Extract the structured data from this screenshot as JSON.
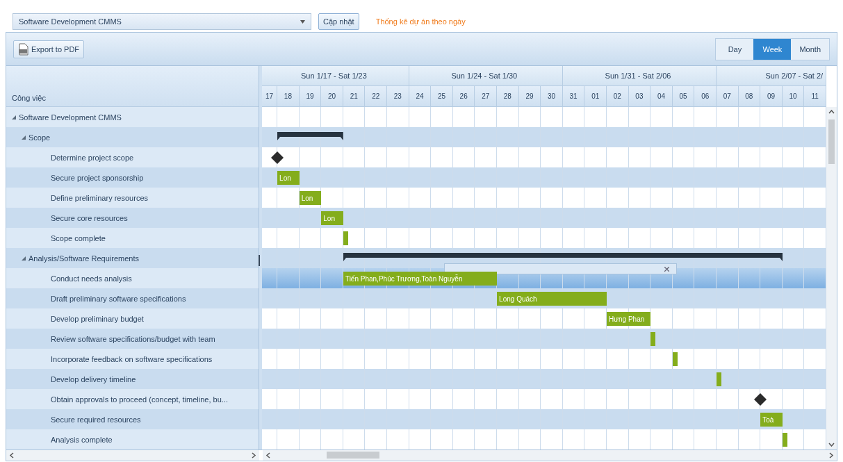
{
  "top_bar": {
    "project_select": {
      "value": "Software Development CMMS"
    },
    "update_button": "Cập nhật",
    "stats_link": "Thống kê dự án theo ngày"
  },
  "toolbar": {
    "export_button": "Export to PDF",
    "views": [
      {
        "label": "Day",
        "selected": false
      },
      {
        "label": "Week",
        "selected": true
      },
      {
        "label": "Month",
        "selected": false
      }
    ]
  },
  "gantt": {
    "column_header": "Công việc",
    "weeks": [
      "Sun 1/17 - Sat 1/23",
      "Sun 1/24 - Sat 1/30",
      "Sun 1/31 - Sat 2/06",
      "Sun 2/07 - Sat 2/"
    ],
    "days": [
      "17",
      "18",
      "19",
      "20",
      "21",
      "22",
      "23",
      "24",
      "25",
      "26",
      "27",
      "28",
      "29",
      "30",
      "31",
      "01",
      "02",
      "03",
      "04",
      "05",
      "06",
      "07",
      "08",
      "09",
      "10",
      "11"
    ],
    "tasks": [
      {
        "name": "Software Development CMMS",
        "expanded": true,
        "selected": false,
        "children": [
          {
            "name": "Scope",
            "expanded": true,
            "selected": false,
            "bar": {
              "kind": "summary",
              "days": [
                false,
                true,
                true,
                true,
                false,
                false,
                false,
                false,
                false,
                false,
                false,
                false,
                false,
                false,
                false,
                false,
                false,
                false,
                false,
                false,
                false,
                false,
                false,
                false,
                false,
                false
              ]
            },
            "children": [
              {
                "name": "Determine project scope",
                "selected": false,
                "bar": {
                  "kind": "milestone",
                  "days": [
                    false,
                    true,
                    false,
                    false,
                    false,
                    false,
                    false,
                    false,
                    false,
                    false,
                    false,
                    false,
                    false,
                    false,
                    false,
                    false,
                    false,
                    false,
                    false,
                    false,
                    false,
                    false,
                    false,
                    false,
                    false,
                    false
                  ]
                }
              },
              {
                "name": "Secure project sponsorship",
                "selected": false,
                "bar": {
                  "kind": "task",
                  "label": "Lon",
                  "days": [
                    false,
                    true,
                    false,
                    false,
                    false,
                    false,
                    false,
                    false,
                    false,
                    false,
                    false,
                    false,
                    false,
                    false,
                    false,
                    false,
                    false,
                    false,
                    false,
                    false,
                    false,
                    false,
                    false,
                    false,
                    false,
                    false
                  ]
                }
              },
              {
                "name": "Define preliminary resources",
                "selected": false,
                "bar": {
                  "kind": "task",
                  "label": "Lon",
                  "days": [
                    false,
                    false,
                    true,
                    false,
                    false,
                    false,
                    false,
                    false,
                    false,
                    false,
                    false,
                    false,
                    false,
                    false,
                    false,
                    false,
                    false,
                    false,
                    false,
                    false,
                    false,
                    false,
                    false,
                    false,
                    false,
                    false
                  ]
                }
              },
              {
                "name": "Secure core resources",
                "selected": false,
                "bar": {
                  "kind": "task",
                  "label": "Lon",
                  "days": [
                    false,
                    false,
                    false,
                    true,
                    false,
                    false,
                    false,
                    false,
                    false,
                    false,
                    false,
                    false,
                    false,
                    false,
                    false,
                    false,
                    false,
                    false,
                    false,
                    false,
                    false,
                    false,
                    false,
                    false,
                    false,
                    false
                  ]
                }
              },
              {
                "name": "Scope complete",
                "selected": false,
                "bar": {
                  "kind": "tick",
                  "days": [
                    false,
                    false,
                    false,
                    false,
                    true,
                    false,
                    false,
                    false,
                    false,
                    false,
                    false,
                    false,
                    false,
                    false,
                    false,
                    false,
                    false,
                    false,
                    false,
                    false,
                    false,
                    false,
                    false,
                    false,
                    false,
                    false
                  ]
                }
              }
            ]
          },
          {
            "name": "Analysis/Software Requirements",
            "expanded": true,
            "selected": false,
            "bar": {
              "kind": "summary",
              "days": [
                false,
                false,
                false,
                false,
                true,
                true,
                true,
                true,
                true,
                true,
                true,
                true,
                true,
                true,
                true,
                true,
                true,
                true,
                true,
                true,
                true,
                true,
                true,
                true,
                false,
                false
              ]
            },
            "children": [
              {
                "name": "Conduct needs analysis",
                "selected": true,
                "bar": {
                  "kind": "task",
                  "label": "Tiến Phan,Phúc Trương,Toàn Nguyễn",
                  "days": [
                    false,
                    false,
                    false,
                    false,
                    true,
                    true,
                    true,
                    true,
                    true,
                    true,
                    true,
                    false,
                    false,
                    false,
                    false,
                    false,
                    false,
                    false,
                    false,
                    false,
                    false,
                    false,
                    false,
                    false,
                    false,
                    false
                  ]
                }
              },
              {
                "name": "Draft preliminary software specifications",
                "selected": false,
                "bar": {
                  "kind": "task",
                  "label": "Long Quách",
                  "days": [
                    false,
                    false,
                    false,
                    false,
                    false,
                    false,
                    false,
                    false,
                    false,
                    false,
                    false,
                    true,
                    true,
                    true,
                    true,
                    true,
                    false,
                    false,
                    false,
                    false,
                    false,
                    false,
                    false,
                    false,
                    false,
                    false
                  ]
                }
              },
              {
                "name": "Develop preliminary budget",
                "selected": false,
                "bar": {
                  "kind": "task",
                  "label": "Hưng Phan",
                  "days": [
                    false,
                    false,
                    false,
                    false,
                    false,
                    false,
                    false,
                    false,
                    false,
                    false,
                    false,
                    false,
                    false,
                    false,
                    false,
                    false,
                    true,
                    true,
                    false,
                    false,
                    false,
                    false,
                    false,
                    false,
                    false,
                    false
                  ]
                }
              },
              {
                "name": "Review software specifications/budget with team",
                "selected": false,
                "bar": {
                  "kind": "tick",
                  "days": [
                    false,
                    false,
                    false,
                    false,
                    false,
                    false,
                    false,
                    false,
                    false,
                    false,
                    false,
                    false,
                    false,
                    false,
                    false,
                    false,
                    false,
                    false,
                    true,
                    false,
                    false,
                    false,
                    false,
                    false,
                    false,
                    false
                  ]
                }
              },
              {
                "name": "Incorporate feedback on software specifications",
                "selected": false,
                "bar": {
                  "kind": "tick",
                  "days": [
                    false,
                    false,
                    false,
                    false,
                    false,
                    false,
                    false,
                    false,
                    false,
                    false,
                    false,
                    false,
                    false,
                    false,
                    false,
                    false,
                    false,
                    false,
                    false,
                    true,
                    false,
                    false,
                    false,
                    false,
                    false,
                    false
                  ]
                }
              },
              {
                "name": "Develop delivery timeline",
                "selected": false,
                "bar": {
                  "kind": "tick",
                  "days": [
                    false,
                    false,
                    false,
                    false,
                    false,
                    false,
                    false,
                    false,
                    false,
                    false,
                    false,
                    false,
                    false,
                    false,
                    false,
                    false,
                    false,
                    false,
                    false,
                    false,
                    false,
                    true,
                    false,
                    false,
                    false,
                    false
                  ]
                }
              },
              {
                "name": "Obtain approvals to proceed (concept, timeline, bu...",
                "selected": false,
                "bar": {
                  "kind": "milestone",
                  "days": [
                    false,
                    false,
                    false,
                    false,
                    false,
                    false,
                    false,
                    false,
                    false,
                    false,
                    false,
                    false,
                    false,
                    false,
                    false,
                    false,
                    false,
                    false,
                    false,
                    false,
                    false,
                    false,
                    false,
                    true,
                    false,
                    false
                  ]
                }
              },
              {
                "name": "Secure required resources",
                "selected": false,
                "bar": {
                  "kind": "task",
                  "label": "Toà",
                  "days": [
                    false,
                    false,
                    false,
                    false,
                    false,
                    false,
                    false,
                    false,
                    false,
                    false,
                    false,
                    false,
                    false,
                    false,
                    false,
                    false,
                    false,
                    false,
                    false,
                    false,
                    false,
                    false,
                    false,
                    true,
                    false,
                    false
                  ]
                }
              },
              {
                "name": "Analysis complete",
                "selected": false,
                "bar": {
                  "kind": "tick",
                  "days": [
                    false,
                    false,
                    false,
                    false,
                    false,
                    false,
                    false,
                    false,
                    false,
                    false,
                    false,
                    false,
                    false,
                    false,
                    false,
                    false,
                    false,
                    false,
                    false,
                    false,
                    false,
                    false,
                    false,
                    false,
                    true,
                    false
                  ]
                }
              }
            ]
          }
        ]
      }
    ]
  }
}
